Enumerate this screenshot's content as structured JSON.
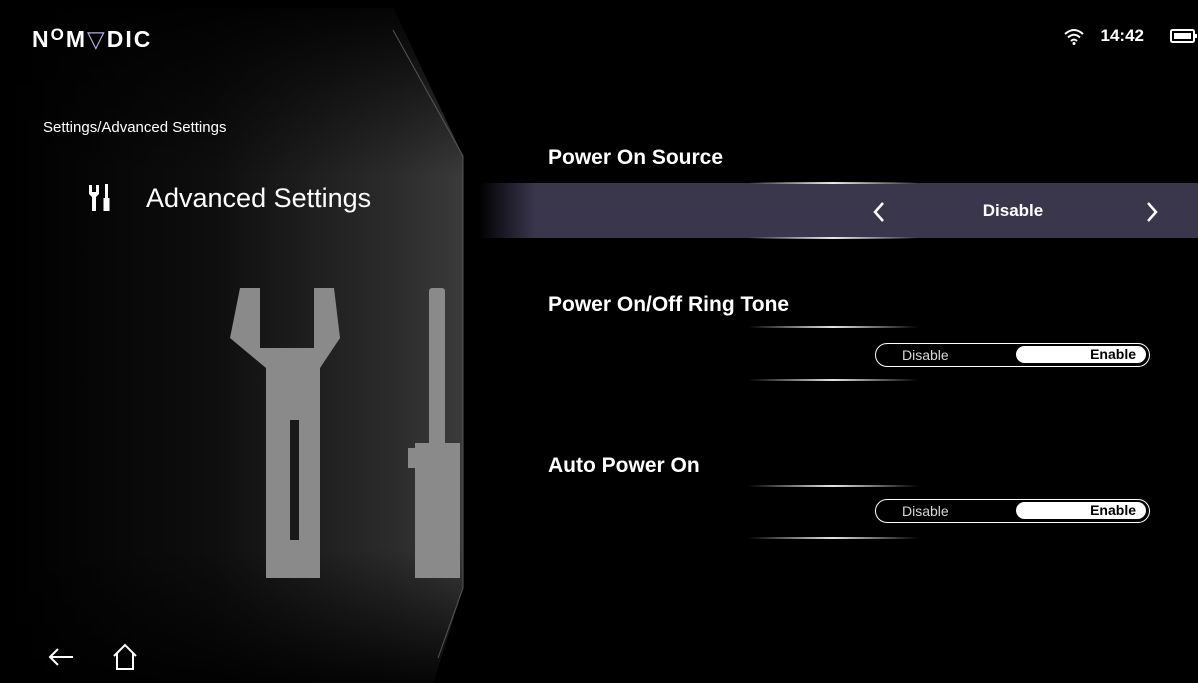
{
  "app": {
    "logo": {
      "part1": "N",
      "part2": "O",
      "part3": "M",
      "part4": "▽",
      "part5": "DIC"
    }
  },
  "status_bar": {
    "time": "14:42",
    "wifi_icon": "wifi-icon",
    "battery_icon": "battery-icon"
  },
  "left_panel": {
    "breadcrumb": "Settings/Advanced Settings",
    "title": "Advanced Settings",
    "title_icon": "tools-icon"
  },
  "settings": [
    {
      "label": "Power On Source",
      "type": "select",
      "value": "Disable"
    },
    {
      "label": "Power On/Off Ring Tone",
      "type": "toggle",
      "off_label": "Disable",
      "on_label": "Enable",
      "selected": "Enable"
    },
    {
      "label": "Auto Power On",
      "type": "toggle",
      "off_label": "Disable",
      "on_label": "Enable",
      "selected": "Enable"
    }
  ],
  "navigation": {
    "back_icon": "back-arrow-icon",
    "home_icon": "home-icon"
  },
  "colors": {
    "background": "#000000",
    "highlight": "#3a374d",
    "text": "#ffffff",
    "logo_accent": "#b7a9df"
  }
}
